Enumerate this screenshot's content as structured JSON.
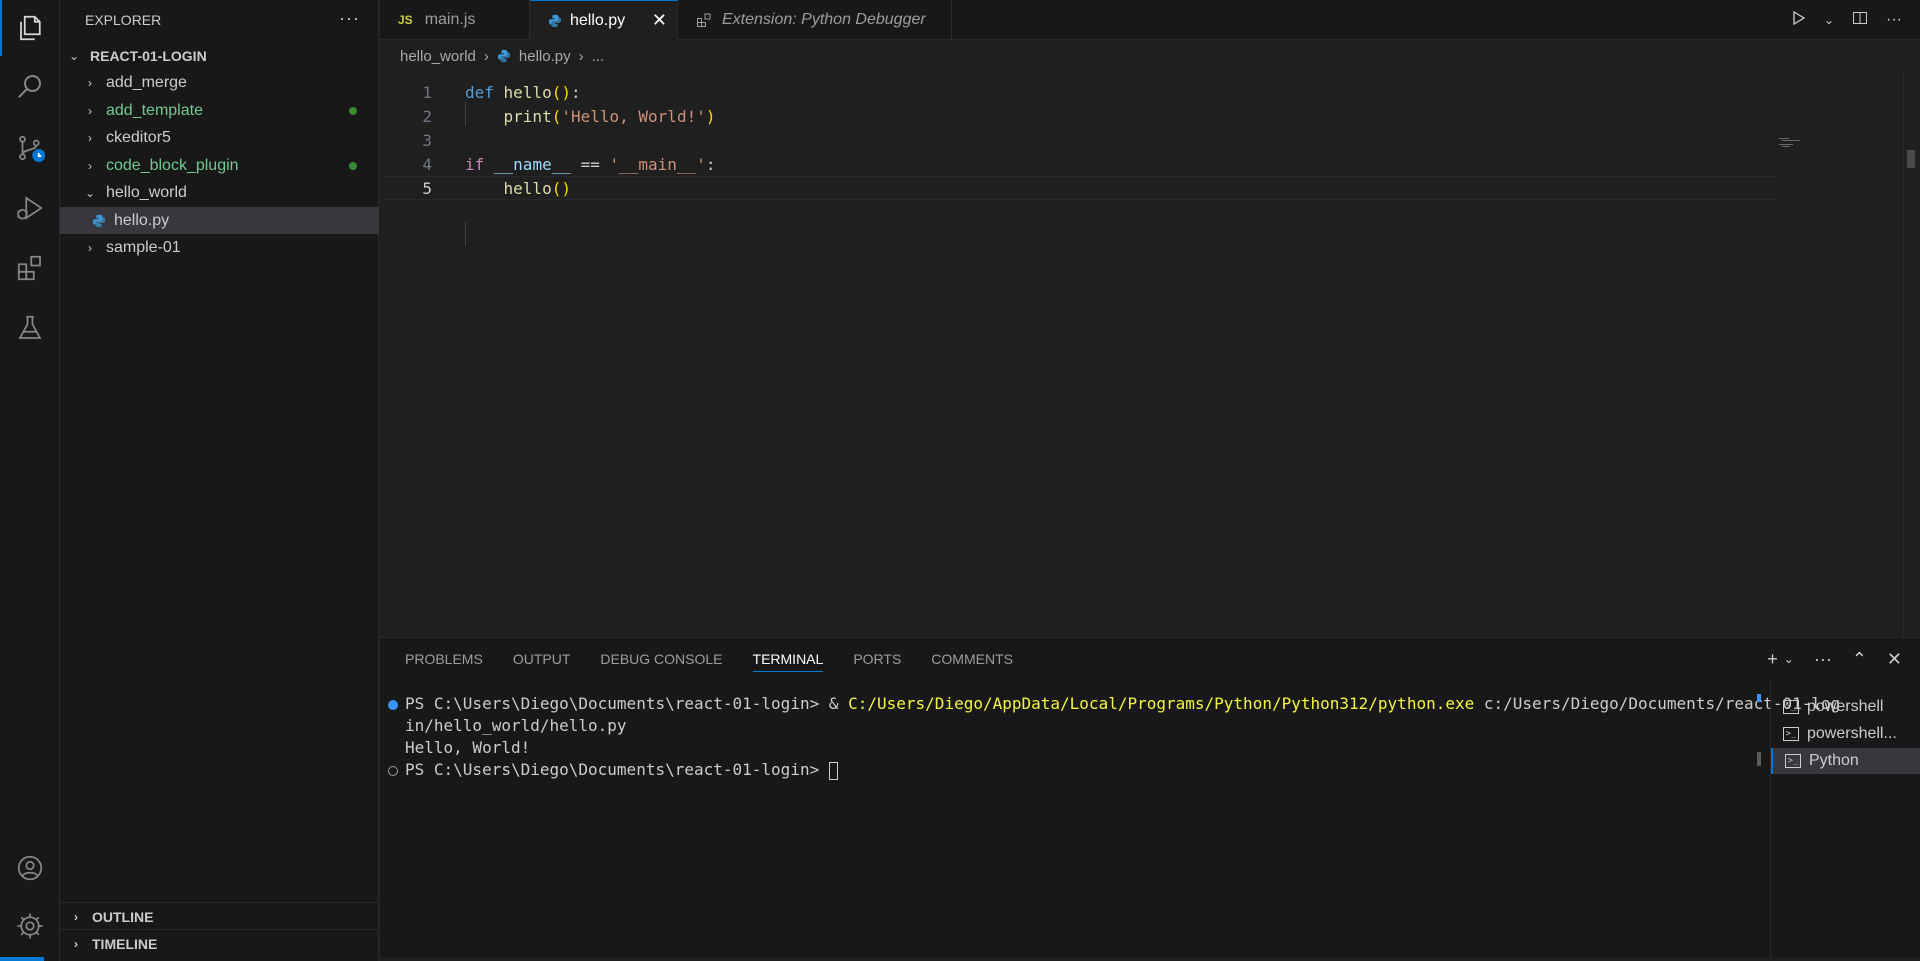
{
  "sidebar": {
    "title": "EXPLORER",
    "more": "···",
    "root": "REACT-01-LOGIN",
    "items": [
      {
        "label": "add_merge"
      },
      {
        "label": "add_template"
      },
      {
        "label": "ckeditor5"
      },
      {
        "label": "code_block_plugin"
      },
      {
        "label": "hello_world"
      },
      {
        "label": "hello.py"
      },
      {
        "label": "sample-01"
      }
    ],
    "outline": "OUTLINE",
    "timeline": "TIMELINE"
  },
  "tabs": [
    {
      "icon": "JS",
      "label": "main.js"
    },
    {
      "label": "hello.py",
      "close": "✕"
    },
    {
      "label": "Extension: Python Debugger"
    }
  ],
  "breadcrumb": {
    "folder": "hello_world",
    "file": "hello.py",
    "rest": "..."
  },
  "editor": {
    "line_numbers": [
      "1",
      "2",
      "3",
      "4",
      "5"
    ],
    "lines": {
      "l1_kw": "def",
      "l1_fn": "hello",
      "l1_open": "()",
      "l1_colon": ":",
      "l2_fn": "print",
      "l2_open": "(",
      "l2_str": "'Hello, World!'",
      "l2_close": ")",
      "l4_kw": "if",
      "l4_var": "__name__",
      "l4_op": " == ",
      "l4_str": "'__main__'",
      "l4_colon": ":",
      "l5_fn": "hello",
      "l5_paren": "()"
    }
  },
  "panel": {
    "tabs": [
      "PROBLEMS",
      "OUTPUT",
      "DEBUG CONSOLE",
      "TERMINAL",
      "PORTS",
      "COMMENTS"
    ],
    "actions": [
      "+",
      "⌄",
      "···",
      "⌃",
      "✕"
    ]
  },
  "terminal": {
    "line1_prompt": "PS C:\\Users\\Diego\\Documents\\react-01-login> & ",
    "line1_exe": "C:/Users/Diego/AppData/Local/Programs/Python/Python312/python.exe",
    "line1_arg": " c:/Users/Diego/Documents/react-01-log",
    "line2": "in/hello_world/hello.py",
    "line3": "Hello, World!",
    "line4_prompt": "PS C:\\Users\\Diego\\Documents\\react-01-login> "
  },
  "terminal_list": [
    {
      "label": "powershell"
    },
    {
      "label": "powershell..."
    },
    {
      "label": "Python"
    }
  ],
  "colors": {
    "accent": "#0078d4",
    "git_added": "#73c991"
  }
}
